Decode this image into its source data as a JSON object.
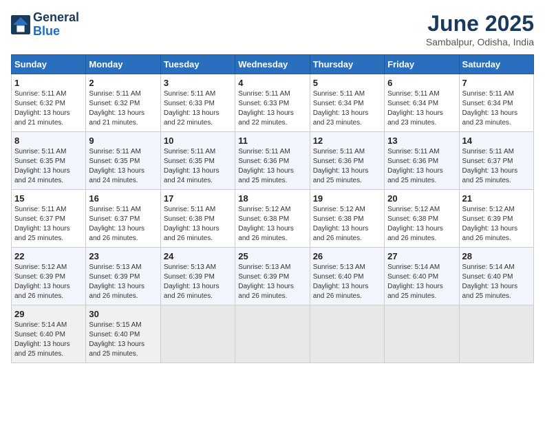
{
  "logo": {
    "line1": "General",
    "line2": "Blue"
  },
  "title": {
    "month_year": "June 2025",
    "location": "Sambalpur, Odisha, India"
  },
  "weekdays": [
    "Sunday",
    "Monday",
    "Tuesday",
    "Wednesday",
    "Thursday",
    "Friday",
    "Saturday"
  ],
  "weeks": [
    [
      {
        "day": "1",
        "sunrise": "5:11 AM",
        "sunset": "6:32 PM",
        "daylight": "13 hours and 21 minutes."
      },
      {
        "day": "2",
        "sunrise": "5:11 AM",
        "sunset": "6:32 PM",
        "daylight": "13 hours and 21 minutes."
      },
      {
        "day": "3",
        "sunrise": "5:11 AM",
        "sunset": "6:33 PM",
        "daylight": "13 hours and 22 minutes."
      },
      {
        "day": "4",
        "sunrise": "5:11 AM",
        "sunset": "6:33 PM",
        "daylight": "13 hours and 22 minutes."
      },
      {
        "day": "5",
        "sunrise": "5:11 AM",
        "sunset": "6:34 PM",
        "daylight": "13 hours and 23 minutes."
      },
      {
        "day": "6",
        "sunrise": "5:11 AM",
        "sunset": "6:34 PM",
        "daylight": "13 hours and 23 minutes."
      },
      {
        "day": "7",
        "sunrise": "5:11 AM",
        "sunset": "6:34 PM",
        "daylight": "13 hours and 23 minutes."
      }
    ],
    [
      {
        "day": "8",
        "sunrise": "5:11 AM",
        "sunset": "6:35 PM",
        "daylight": "13 hours and 24 minutes."
      },
      {
        "day": "9",
        "sunrise": "5:11 AM",
        "sunset": "6:35 PM",
        "daylight": "13 hours and 24 minutes."
      },
      {
        "day": "10",
        "sunrise": "5:11 AM",
        "sunset": "6:35 PM",
        "daylight": "13 hours and 24 minutes."
      },
      {
        "day": "11",
        "sunrise": "5:11 AM",
        "sunset": "6:36 PM",
        "daylight": "13 hours and 25 minutes."
      },
      {
        "day": "12",
        "sunrise": "5:11 AM",
        "sunset": "6:36 PM",
        "daylight": "13 hours and 25 minutes."
      },
      {
        "day": "13",
        "sunrise": "5:11 AM",
        "sunset": "6:36 PM",
        "daylight": "13 hours and 25 minutes."
      },
      {
        "day": "14",
        "sunrise": "5:11 AM",
        "sunset": "6:37 PM",
        "daylight": "13 hours and 25 minutes."
      }
    ],
    [
      {
        "day": "15",
        "sunrise": "5:11 AM",
        "sunset": "6:37 PM",
        "daylight": "13 hours and 25 minutes."
      },
      {
        "day": "16",
        "sunrise": "5:11 AM",
        "sunset": "6:37 PM",
        "daylight": "13 hours and 26 minutes."
      },
      {
        "day": "17",
        "sunrise": "5:11 AM",
        "sunset": "6:38 PM",
        "daylight": "13 hours and 26 minutes."
      },
      {
        "day": "18",
        "sunrise": "5:12 AM",
        "sunset": "6:38 PM",
        "daylight": "13 hours and 26 minutes."
      },
      {
        "day": "19",
        "sunrise": "5:12 AM",
        "sunset": "6:38 PM",
        "daylight": "13 hours and 26 minutes."
      },
      {
        "day": "20",
        "sunrise": "5:12 AM",
        "sunset": "6:38 PM",
        "daylight": "13 hours and 26 minutes."
      },
      {
        "day": "21",
        "sunrise": "5:12 AM",
        "sunset": "6:39 PM",
        "daylight": "13 hours and 26 minutes."
      }
    ],
    [
      {
        "day": "22",
        "sunrise": "5:12 AM",
        "sunset": "6:39 PM",
        "daylight": "13 hours and 26 minutes."
      },
      {
        "day": "23",
        "sunrise": "5:13 AM",
        "sunset": "6:39 PM",
        "daylight": "13 hours and 26 minutes."
      },
      {
        "day": "24",
        "sunrise": "5:13 AM",
        "sunset": "6:39 PM",
        "daylight": "13 hours and 26 minutes."
      },
      {
        "day": "25",
        "sunrise": "5:13 AM",
        "sunset": "6:39 PM",
        "daylight": "13 hours and 26 minutes."
      },
      {
        "day": "26",
        "sunrise": "5:13 AM",
        "sunset": "6:40 PM",
        "daylight": "13 hours and 26 minutes."
      },
      {
        "day": "27",
        "sunrise": "5:14 AM",
        "sunset": "6:40 PM",
        "daylight": "13 hours and 25 minutes."
      },
      {
        "day": "28",
        "sunrise": "5:14 AM",
        "sunset": "6:40 PM",
        "daylight": "13 hours and 25 minutes."
      }
    ],
    [
      {
        "day": "29",
        "sunrise": "5:14 AM",
        "sunset": "6:40 PM",
        "daylight": "13 hours and 25 minutes."
      },
      {
        "day": "30",
        "sunrise": "5:15 AM",
        "sunset": "6:40 PM",
        "daylight": "13 hours and 25 minutes."
      },
      null,
      null,
      null,
      null,
      null
    ]
  ]
}
